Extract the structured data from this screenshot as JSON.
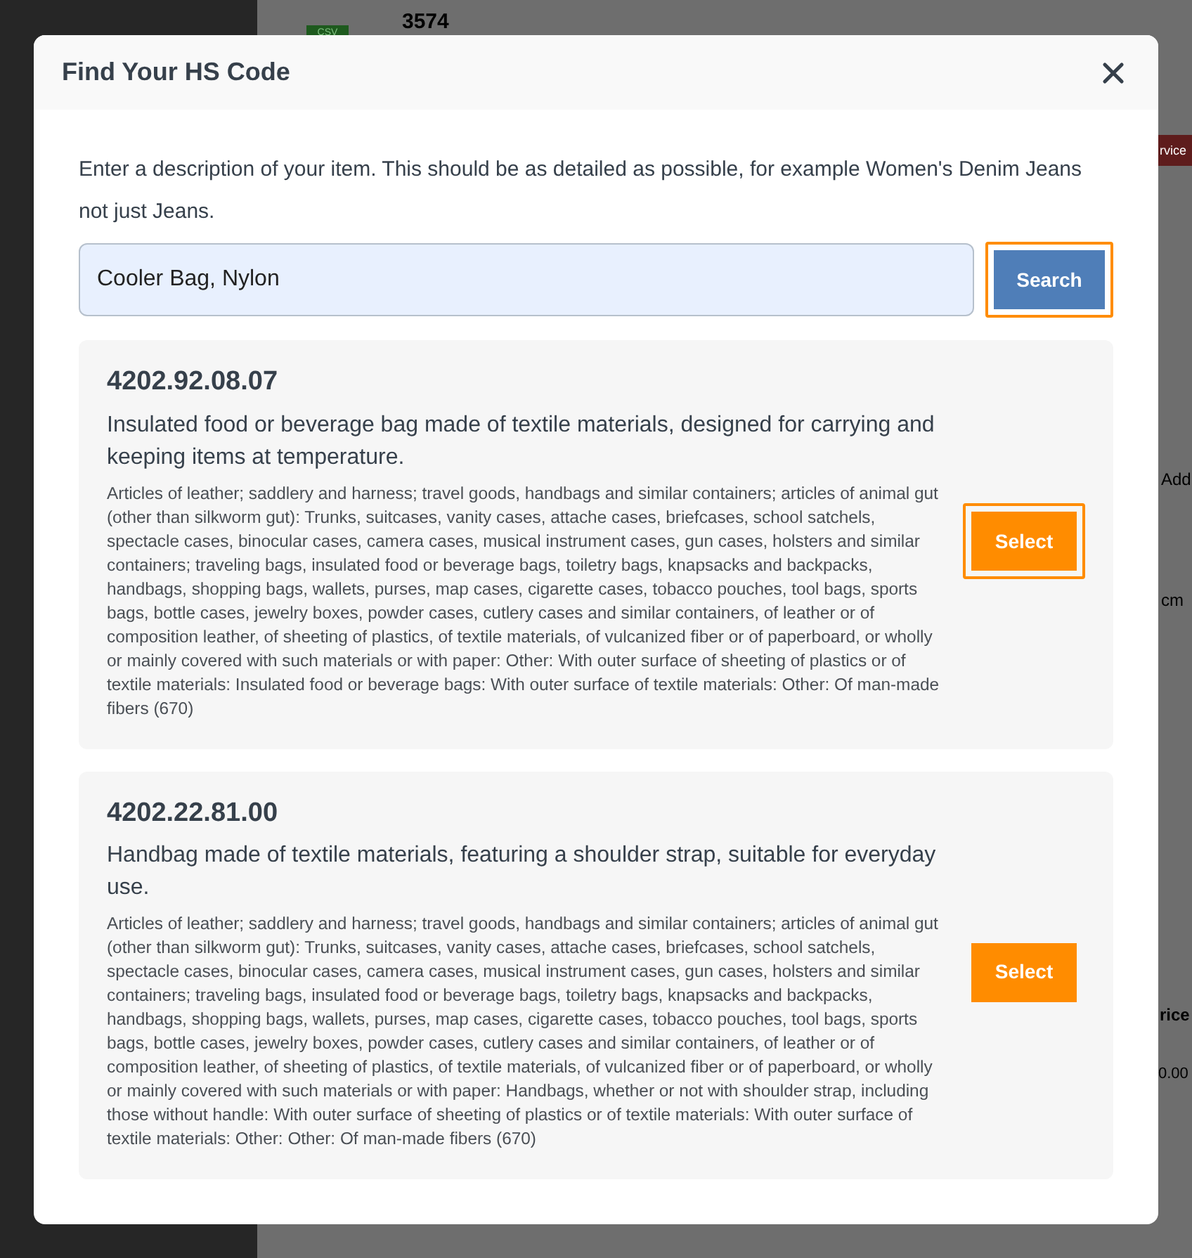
{
  "backdrop": {
    "csv_badge": "CSV",
    "texts": [
      "3574",
      "rvice",
      "Add",
      "cm",
      "rice",
      "0.00"
    ]
  },
  "modal": {
    "title": "Find Your HS Code",
    "instructions": "Enter a description of your item. This should be as detailed as possible, for example Women's Denim Jeans not just Jeans.",
    "search": {
      "value": "Cooler Bag, Nylon",
      "button": {
        "label": "Search",
        "highlighted": true
      }
    },
    "results": [
      {
        "code": "4202.92.08.07",
        "title": "Insulated food or beverage bag made of textile materials, designed for carrying and keeping items at temperature.",
        "description": "Articles of leather; saddlery and harness; travel goods, handbags and similar containers; articles of animal gut (other than silkworm gut): Trunks, suitcases, vanity cases, attache cases, briefcases, school satchels, spectacle cases, binocular cases, camera cases, musical instrument cases, gun cases, holsters and similar containers; traveling bags, insulated food or beverage bags, toiletry bags, knapsacks and backpacks, handbags, shopping bags, wallets, purses, map cases, cigarette cases, tobacco pouches, tool bags, sports bags, bottle cases, jewelry boxes, powder cases, cutlery cases and similar containers, of leather or of composition leather, of sheeting of plastics, of textile materials, of vulcanized fiber or of paperboard, or wholly or mainly covered with such materials or with paper: Other: With outer surface of sheeting of plastics or of textile materials: Insulated food or beverage bags: With outer surface of textile materials: Other: Of man-made fibers (670)",
        "button": {
          "label": "Select",
          "highlighted": true
        }
      },
      {
        "code": "4202.22.81.00",
        "title": "Handbag made of textile materials, featuring a shoulder strap, suitable for everyday use.",
        "description": "Articles of leather; saddlery and harness; travel goods, handbags and similar containers; articles of animal gut (other than silkworm gut): Trunks, suitcases, vanity cases, attache cases, briefcases, school satchels, spectacle cases, binocular cases, camera cases, musical instrument cases, gun cases, holsters and similar containers; traveling bags, insulated food or beverage bags, toiletry bags, knapsacks and backpacks, handbags, shopping bags, wallets, purses, map cases, cigarette cases, tobacco pouches, tool bags, sports bags, bottle cases, jewelry boxes, powder cases, cutlery cases and similar containers, of leather or of composition leather, of sheeting of plastics, of textile materials, of vulcanized fiber or of paperboard, or wholly or mainly covered with such materials or with paper: Handbags, whether or not with shoulder strap, including those without handle: With outer surface of sheeting of plastics or of textile materials: With outer surface of textile materials: Other: Other: Of man-made fibers (670)",
        "button": {
          "label": "Select",
          "highlighted": false
        }
      }
    ]
  }
}
